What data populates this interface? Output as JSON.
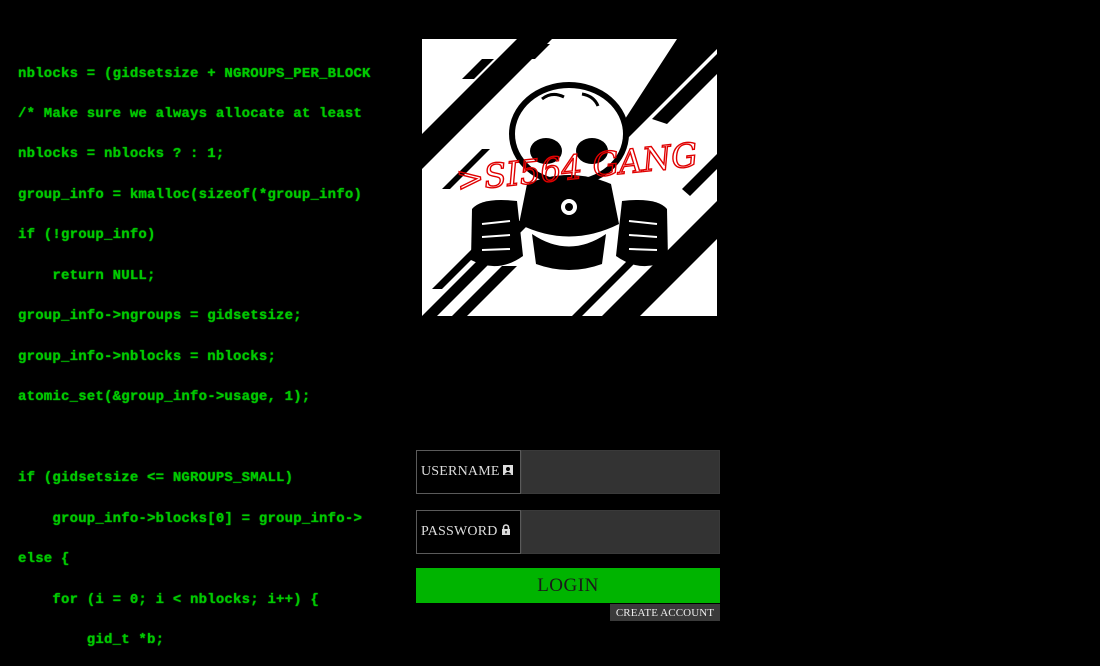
{
  "background_code": {
    "lines": [
      "nblocks = (gidsetsize + NGROUPS_PER_BLOCK",
      "/* Make sure we always allocate at least",
      "nblocks = nblocks ? : 1;",
      "group_info = kmalloc(sizeof(*group_info)                             P_USER);",
      "if (!group_info)",
      "    return NULL;",
      "group_info->ngroups = gidsetsize;",
      "group_info->nblocks = nblocks;",
      "atomic_set(&group_info->usage, 1);",
      "",
      "if (gidsetsize <= NGROUPS_SMALL)",
      "    group_info->blocks[0] = group_info->",
      "else {",
      "    for (i = 0; i < nblocks; i++) {",
      "        gid_t *b;"
    ],
    "color": "#00c800"
  },
  "logo": {
    "text": ">SI564 GANG",
    "text_color": "#e00000",
    "icon": "skull-gas-mask-icon"
  },
  "login_form": {
    "username_label": "USERNAME",
    "username_icon": "user-icon",
    "username_value": "",
    "password_label": "PASSWORD",
    "password_icon": "lock-icon",
    "password_value": "",
    "login_label": "LOGIN",
    "create_account_label": "CREATE ACCOUNT",
    "accent_color": "#00b400"
  }
}
